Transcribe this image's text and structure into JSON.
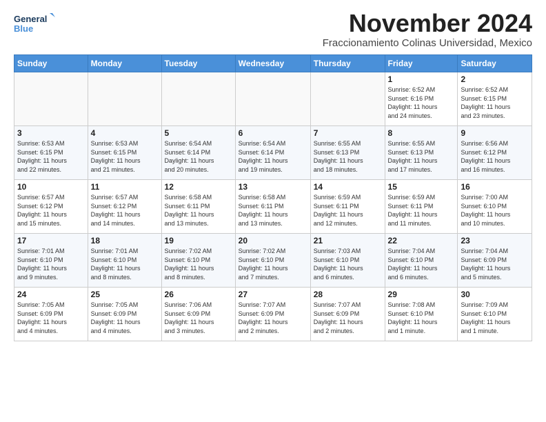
{
  "logo": {
    "line1": "General",
    "line2": "Blue"
  },
  "title": "November 2024",
  "subtitle": "Fraccionamiento Colinas Universidad, Mexico",
  "weekdays": [
    "Sunday",
    "Monday",
    "Tuesday",
    "Wednesday",
    "Thursday",
    "Friday",
    "Saturday"
  ],
  "weeks": [
    [
      {
        "day": "",
        "info": ""
      },
      {
        "day": "",
        "info": ""
      },
      {
        "day": "",
        "info": ""
      },
      {
        "day": "",
        "info": ""
      },
      {
        "day": "",
        "info": ""
      },
      {
        "day": "1",
        "info": "Sunrise: 6:52 AM\nSunset: 6:16 PM\nDaylight: 11 hours\nand 24 minutes."
      },
      {
        "day": "2",
        "info": "Sunrise: 6:52 AM\nSunset: 6:15 PM\nDaylight: 11 hours\nand 23 minutes."
      }
    ],
    [
      {
        "day": "3",
        "info": "Sunrise: 6:53 AM\nSunset: 6:15 PM\nDaylight: 11 hours\nand 22 minutes."
      },
      {
        "day": "4",
        "info": "Sunrise: 6:53 AM\nSunset: 6:15 PM\nDaylight: 11 hours\nand 21 minutes."
      },
      {
        "day": "5",
        "info": "Sunrise: 6:54 AM\nSunset: 6:14 PM\nDaylight: 11 hours\nand 20 minutes."
      },
      {
        "day": "6",
        "info": "Sunrise: 6:54 AM\nSunset: 6:14 PM\nDaylight: 11 hours\nand 19 minutes."
      },
      {
        "day": "7",
        "info": "Sunrise: 6:55 AM\nSunset: 6:13 PM\nDaylight: 11 hours\nand 18 minutes."
      },
      {
        "day": "8",
        "info": "Sunrise: 6:55 AM\nSunset: 6:13 PM\nDaylight: 11 hours\nand 17 minutes."
      },
      {
        "day": "9",
        "info": "Sunrise: 6:56 AM\nSunset: 6:12 PM\nDaylight: 11 hours\nand 16 minutes."
      }
    ],
    [
      {
        "day": "10",
        "info": "Sunrise: 6:57 AM\nSunset: 6:12 PM\nDaylight: 11 hours\nand 15 minutes."
      },
      {
        "day": "11",
        "info": "Sunrise: 6:57 AM\nSunset: 6:12 PM\nDaylight: 11 hours\nand 14 minutes."
      },
      {
        "day": "12",
        "info": "Sunrise: 6:58 AM\nSunset: 6:11 PM\nDaylight: 11 hours\nand 13 minutes."
      },
      {
        "day": "13",
        "info": "Sunrise: 6:58 AM\nSunset: 6:11 PM\nDaylight: 11 hours\nand 13 minutes."
      },
      {
        "day": "14",
        "info": "Sunrise: 6:59 AM\nSunset: 6:11 PM\nDaylight: 11 hours\nand 12 minutes."
      },
      {
        "day": "15",
        "info": "Sunrise: 6:59 AM\nSunset: 6:11 PM\nDaylight: 11 hours\nand 11 minutes."
      },
      {
        "day": "16",
        "info": "Sunrise: 7:00 AM\nSunset: 6:10 PM\nDaylight: 11 hours\nand 10 minutes."
      }
    ],
    [
      {
        "day": "17",
        "info": "Sunrise: 7:01 AM\nSunset: 6:10 PM\nDaylight: 11 hours\nand 9 minutes."
      },
      {
        "day": "18",
        "info": "Sunrise: 7:01 AM\nSunset: 6:10 PM\nDaylight: 11 hours\nand 8 minutes."
      },
      {
        "day": "19",
        "info": "Sunrise: 7:02 AM\nSunset: 6:10 PM\nDaylight: 11 hours\nand 8 minutes."
      },
      {
        "day": "20",
        "info": "Sunrise: 7:02 AM\nSunset: 6:10 PM\nDaylight: 11 hours\nand 7 minutes."
      },
      {
        "day": "21",
        "info": "Sunrise: 7:03 AM\nSunset: 6:10 PM\nDaylight: 11 hours\nand 6 minutes."
      },
      {
        "day": "22",
        "info": "Sunrise: 7:04 AM\nSunset: 6:10 PM\nDaylight: 11 hours\nand 6 minutes."
      },
      {
        "day": "23",
        "info": "Sunrise: 7:04 AM\nSunset: 6:09 PM\nDaylight: 11 hours\nand 5 minutes."
      }
    ],
    [
      {
        "day": "24",
        "info": "Sunrise: 7:05 AM\nSunset: 6:09 PM\nDaylight: 11 hours\nand 4 minutes."
      },
      {
        "day": "25",
        "info": "Sunrise: 7:05 AM\nSunset: 6:09 PM\nDaylight: 11 hours\nand 4 minutes."
      },
      {
        "day": "26",
        "info": "Sunrise: 7:06 AM\nSunset: 6:09 PM\nDaylight: 11 hours\nand 3 minutes."
      },
      {
        "day": "27",
        "info": "Sunrise: 7:07 AM\nSunset: 6:09 PM\nDaylight: 11 hours\nand 2 minutes."
      },
      {
        "day": "28",
        "info": "Sunrise: 7:07 AM\nSunset: 6:09 PM\nDaylight: 11 hours\nand 2 minutes."
      },
      {
        "day": "29",
        "info": "Sunrise: 7:08 AM\nSunset: 6:10 PM\nDaylight: 11 hours\nand 1 minute."
      },
      {
        "day": "30",
        "info": "Sunrise: 7:09 AM\nSunset: 6:10 PM\nDaylight: 11 hours\nand 1 minute."
      }
    ]
  ]
}
